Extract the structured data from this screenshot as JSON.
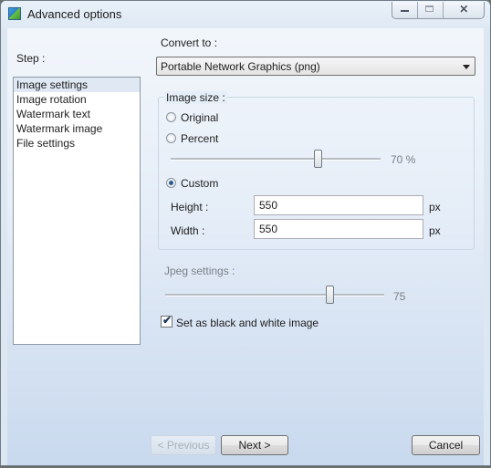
{
  "window": {
    "title": "Advanced options"
  },
  "titlebar": {
    "close_glyph": "✕",
    "icons": [
      "app-icon",
      "minimize-icon",
      "maximize-icon",
      "close-icon"
    ]
  },
  "step": {
    "label": "Step :",
    "items": [
      "Image settings",
      "Image rotation",
      "Watermark text",
      "Watermark image",
      "File settings"
    ],
    "selected": "Image settings"
  },
  "convert": {
    "label": "Convert to :",
    "value": "Portable Network Graphics (png)"
  },
  "image_size": {
    "title": "Image size :",
    "option_original": "Original",
    "option_percent": "Percent",
    "option_custom": "Custom",
    "selected": "Custom",
    "percent_value": 70,
    "percent_text": "70 %",
    "height_label": "Height :",
    "height_value": "550",
    "width_label": "Width :",
    "width_value": "550",
    "unit": "px"
  },
  "jpeg": {
    "label": "Jpeg settings :",
    "quality_value": 75,
    "quality_text": "75"
  },
  "bw": {
    "label": "Set as black and white image",
    "checked": true
  },
  "buttons": {
    "previous": "< Previous",
    "next": "Next >",
    "cancel": "Cancel"
  }
}
